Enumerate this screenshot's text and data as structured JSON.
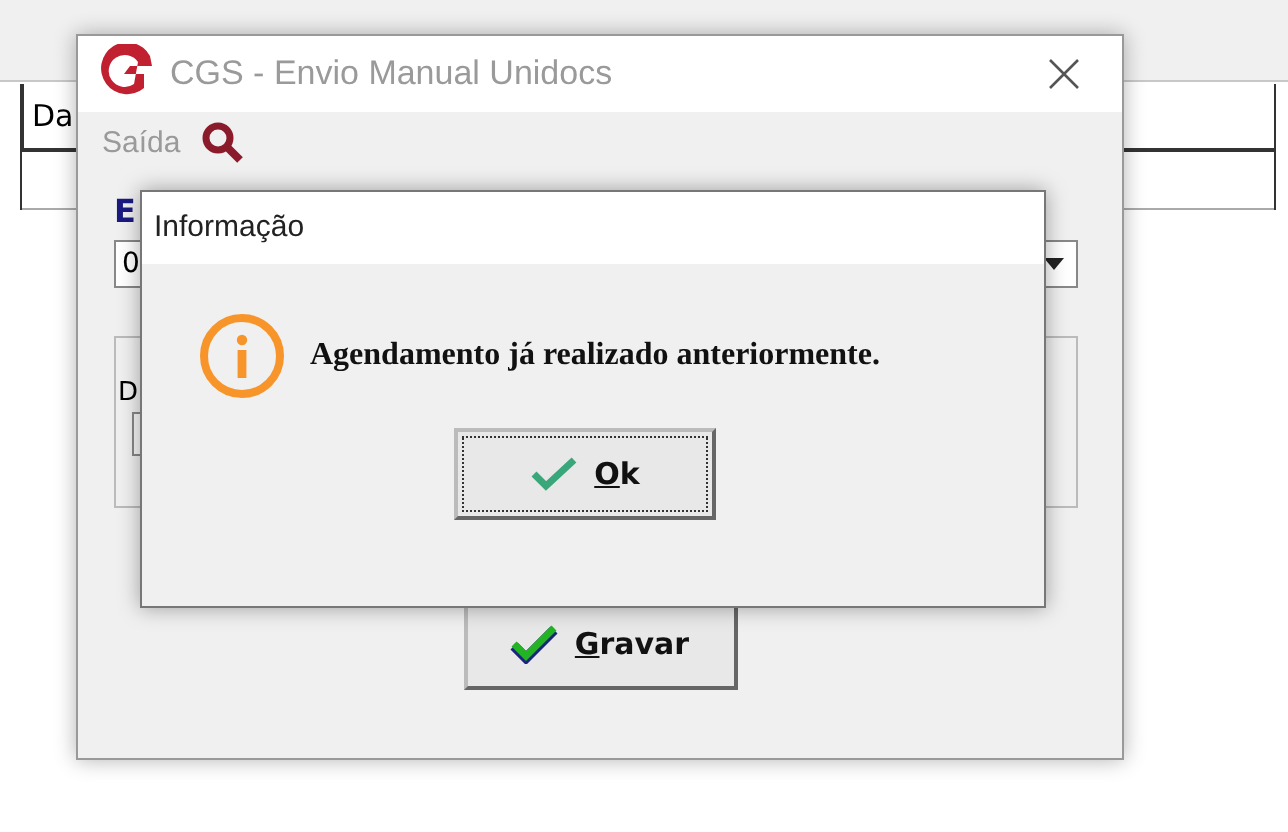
{
  "background_table": {
    "columns": [
      "Da"
    ]
  },
  "window": {
    "title": "CGS - Envio Manual Unidocs",
    "menu": [
      "Saída"
    ],
    "field_label": "E",
    "combo_value": "0",
    "group_label": "D",
    "buttons": [
      {
        "label": "Gravar",
        "focused": false
      }
    ]
  },
  "dialog": {
    "title": "Informação",
    "kind": "info",
    "message": "Agendamento já realizado anteriormente.",
    "buttons": [
      {
        "label": "Ok",
        "focused": true
      }
    ]
  }
}
